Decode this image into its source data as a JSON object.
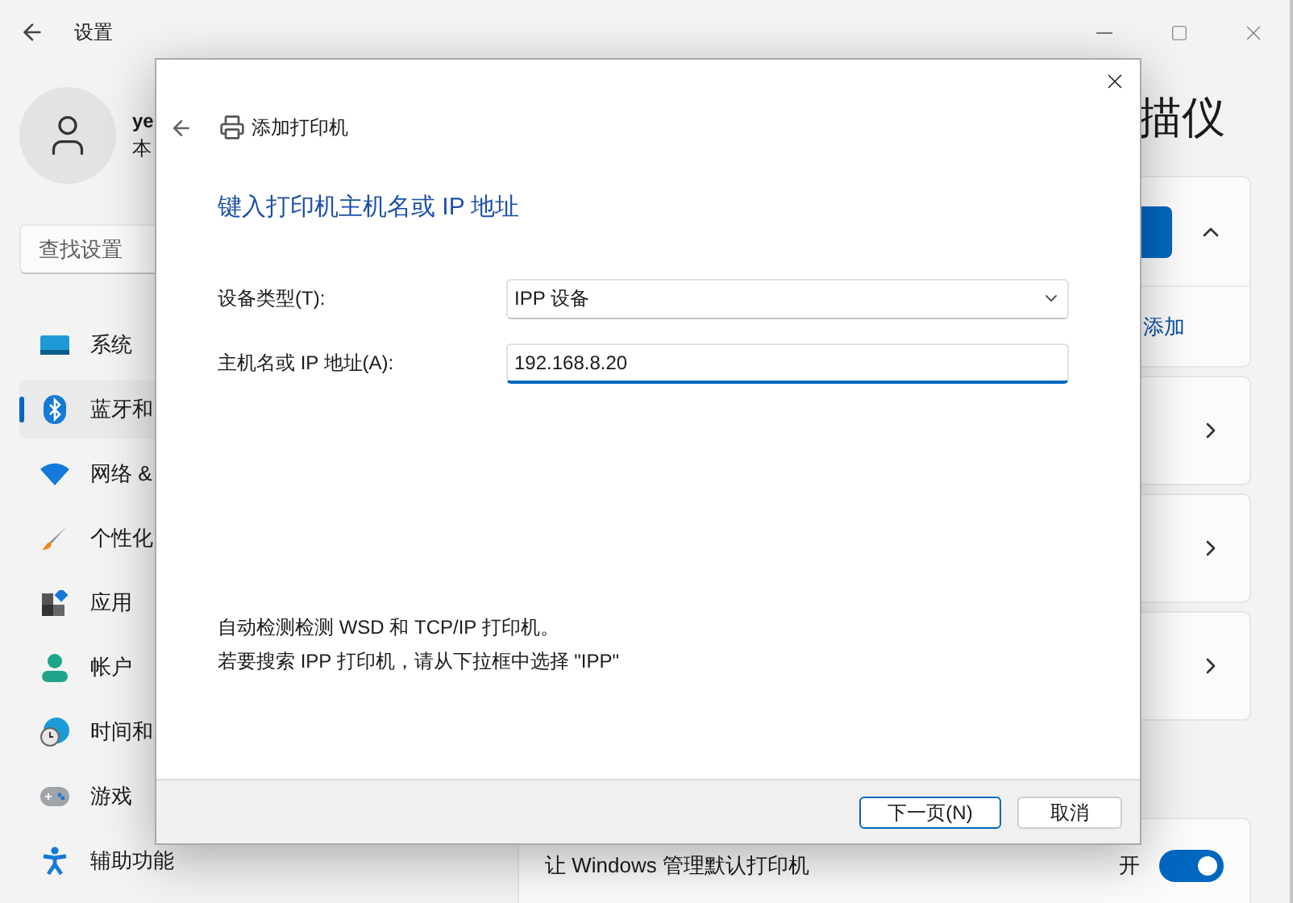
{
  "window": {
    "title": "设置"
  },
  "user": {
    "name": "ye",
    "subtitle": "本"
  },
  "search": {
    "placeholder": "查找设置"
  },
  "sidebar": {
    "items": [
      {
        "label": "系统",
        "selected": false
      },
      {
        "label": "蓝牙和",
        "selected": true
      },
      {
        "label": "网络 &",
        "selected": false
      },
      {
        "label": "个性化",
        "selected": false
      },
      {
        "label": "应用",
        "selected": false
      },
      {
        "label": "帐户",
        "selected": false
      },
      {
        "label": "时间和",
        "selected": false
      },
      {
        "label": "游戏",
        "selected": false
      },
      {
        "label": "辅助功能",
        "selected": false
      }
    ]
  },
  "page_title": "描仪",
  "sections": [
    {
      "kind": "expander",
      "expanded": true,
      "link": "添加"
    },
    {
      "kind": "nav"
    },
    {
      "kind": "nav"
    },
    {
      "kind": "nav"
    }
  ],
  "default_printer": {
    "label": "让 Windows 管理默认打印机",
    "state_text": "开",
    "on": true
  },
  "dialog": {
    "title": "添加打印机",
    "heading": "键入打印机主机名或 IP 地址",
    "fields": [
      {
        "kind": "dropdown",
        "label": "设备类型(T):",
        "value": "IPP 设备"
      },
      {
        "kind": "text",
        "label": "主机名或 IP 地址(A):",
        "value": "192.168.8.20",
        "focused": true
      }
    ],
    "notes": [
      "自动检测检测 WSD 和 TCP/IP 打印机。",
      "若要搜索 IPP 打印机，请从下拉框中选择 \"IPP\""
    ],
    "buttons": [
      {
        "label": "下一页(N)",
        "default": true
      },
      {
        "label": "取消",
        "default": false
      }
    ]
  }
}
